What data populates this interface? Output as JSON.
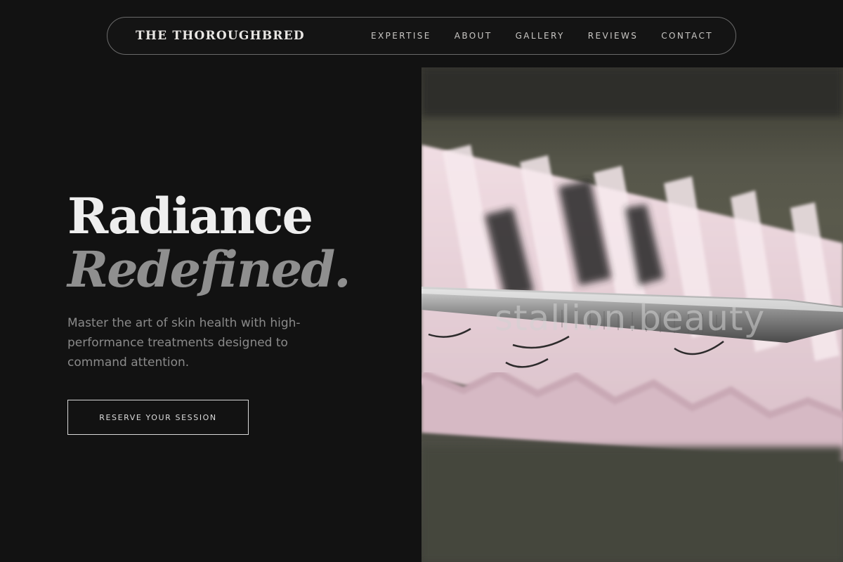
{
  "nav": {
    "brand": "THE THOROUGHBRED",
    "links": [
      "EXPERTISE",
      "ABOUT",
      "GALLERY",
      "REVIEWS",
      "CONTACT"
    ]
  },
  "hero": {
    "title_line1": "Radiance",
    "title_line2": "Redefined.",
    "subtitle": "Master the art of skin health with high-performance treatments designed to command attention.",
    "cta_label": "RESERVE YOUR SESSION"
  },
  "image": {
    "subject": "lash-extension-tray-with-tweezers",
    "watermark": "stallion.beauty"
  },
  "colors": {
    "background": "#121212",
    "text_primary": "#eeeeee",
    "text_muted": "#8a8a8a",
    "tray_pink": "#e9d3da"
  }
}
